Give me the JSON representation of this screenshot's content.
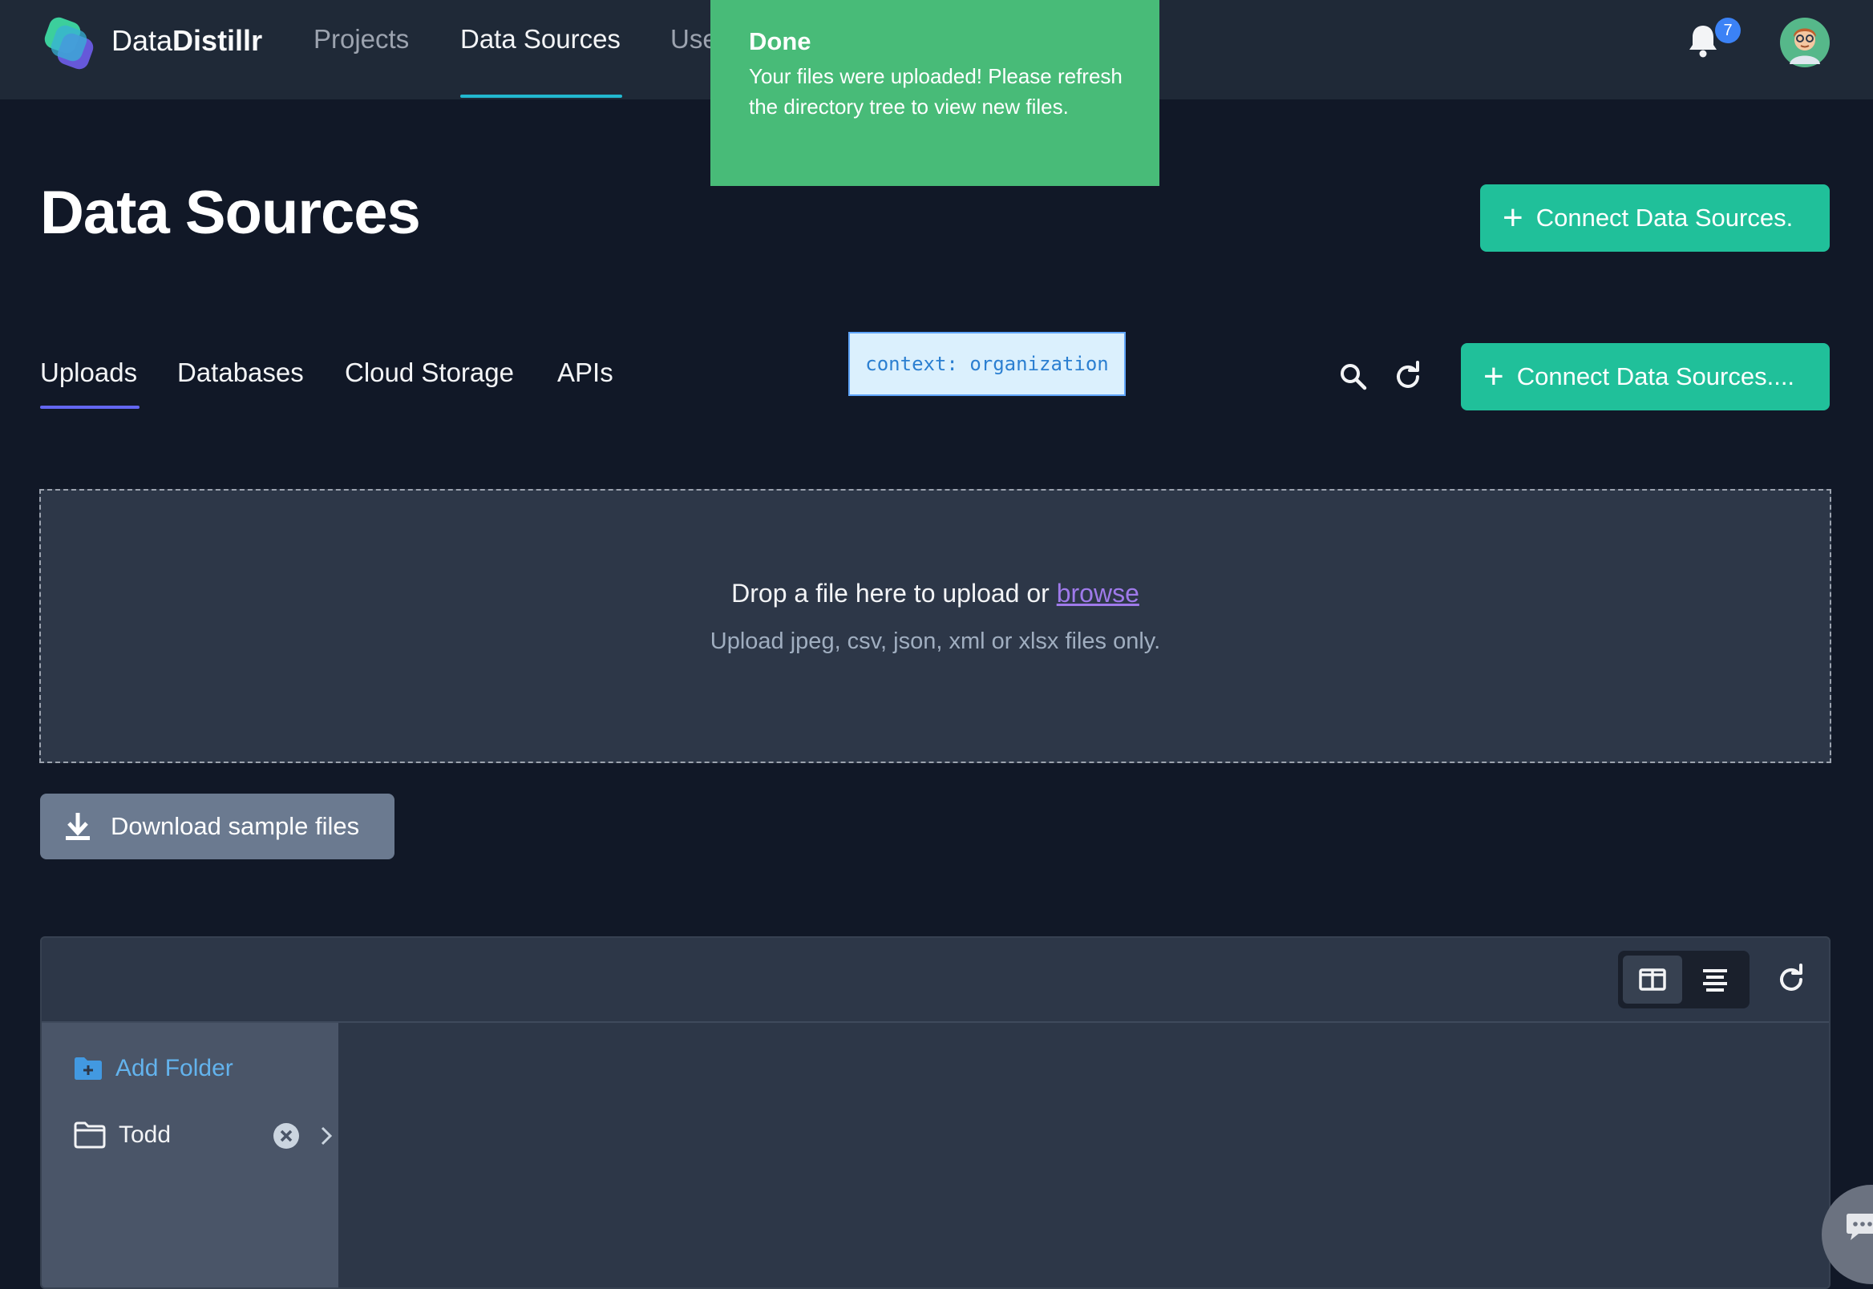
{
  "header": {
    "brand_prefix": "Data",
    "brand_suffix": "Distillr",
    "nav": [
      {
        "label": "Projects",
        "active": false
      },
      {
        "label": "Data Sources",
        "active": true
      },
      {
        "label": "Users",
        "active": false
      }
    ],
    "notification_count": "7"
  },
  "toast": {
    "title": "Done",
    "message": "Your files were uploaded! Please refresh the directory tree to view new files.",
    "color": "#48bb78"
  },
  "page": {
    "title": "Data Sources",
    "connect_button_primary": "Connect Data Sources.",
    "connect_button_secondary": "Connect Data Sources...."
  },
  "tabs": [
    {
      "label": "Uploads",
      "active": true
    },
    {
      "label": "Databases",
      "active": false
    },
    {
      "label": "Cloud Storage",
      "active": false
    },
    {
      "label": "APIs",
      "active": false
    }
  ],
  "context_tag": "context: organization",
  "dropzone": {
    "prompt": "Drop a file here to upload or",
    "browse_link": "browse",
    "hint": "Upload jpeg, csv, json, xml or xlsx files only."
  },
  "download_button": "Download sample files",
  "file_browser": {
    "add_folder": "Add Folder",
    "folders": [
      {
        "name": "Todd"
      }
    ]
  },
  "colors": {
    "accent_teal": "#20c09a",
    "link_purple": "#9f7aea",
    "tab_indicator": "#6366f1",
    "nav_indicator": "#22b8cf"
  }
}
